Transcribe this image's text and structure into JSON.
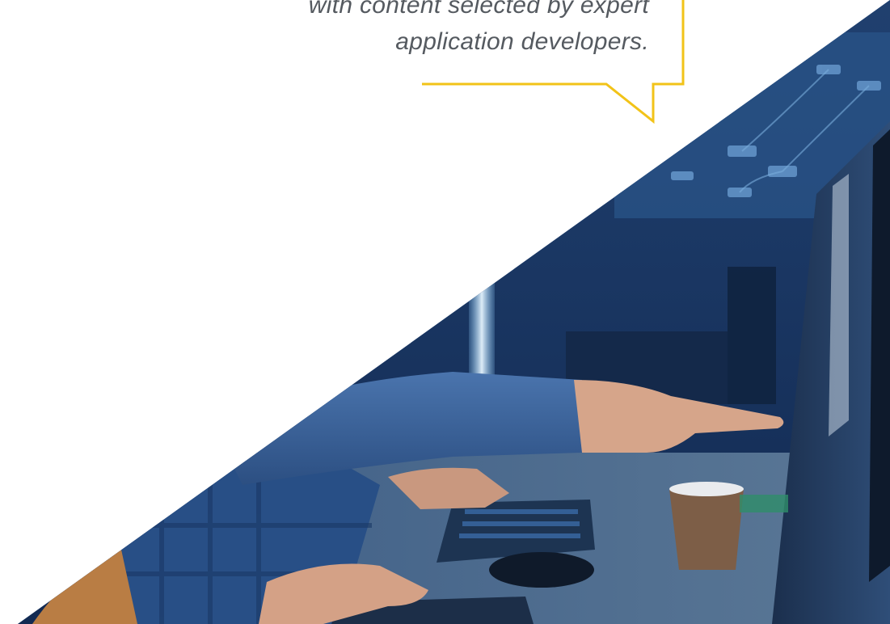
{
  "quote": {
    "lines": [
      "with content selected by expert",
      "application developers."
    ]
  },
  "colors": {
    "accent_yellow": "#f2c318",
    "quote_text": "#555a60",
    "photo_blue": "#1d4a86"
  },
  "photo": {
    "subject": "developers-at-workstation",
    "icon": "photo-icon"
  }
}
